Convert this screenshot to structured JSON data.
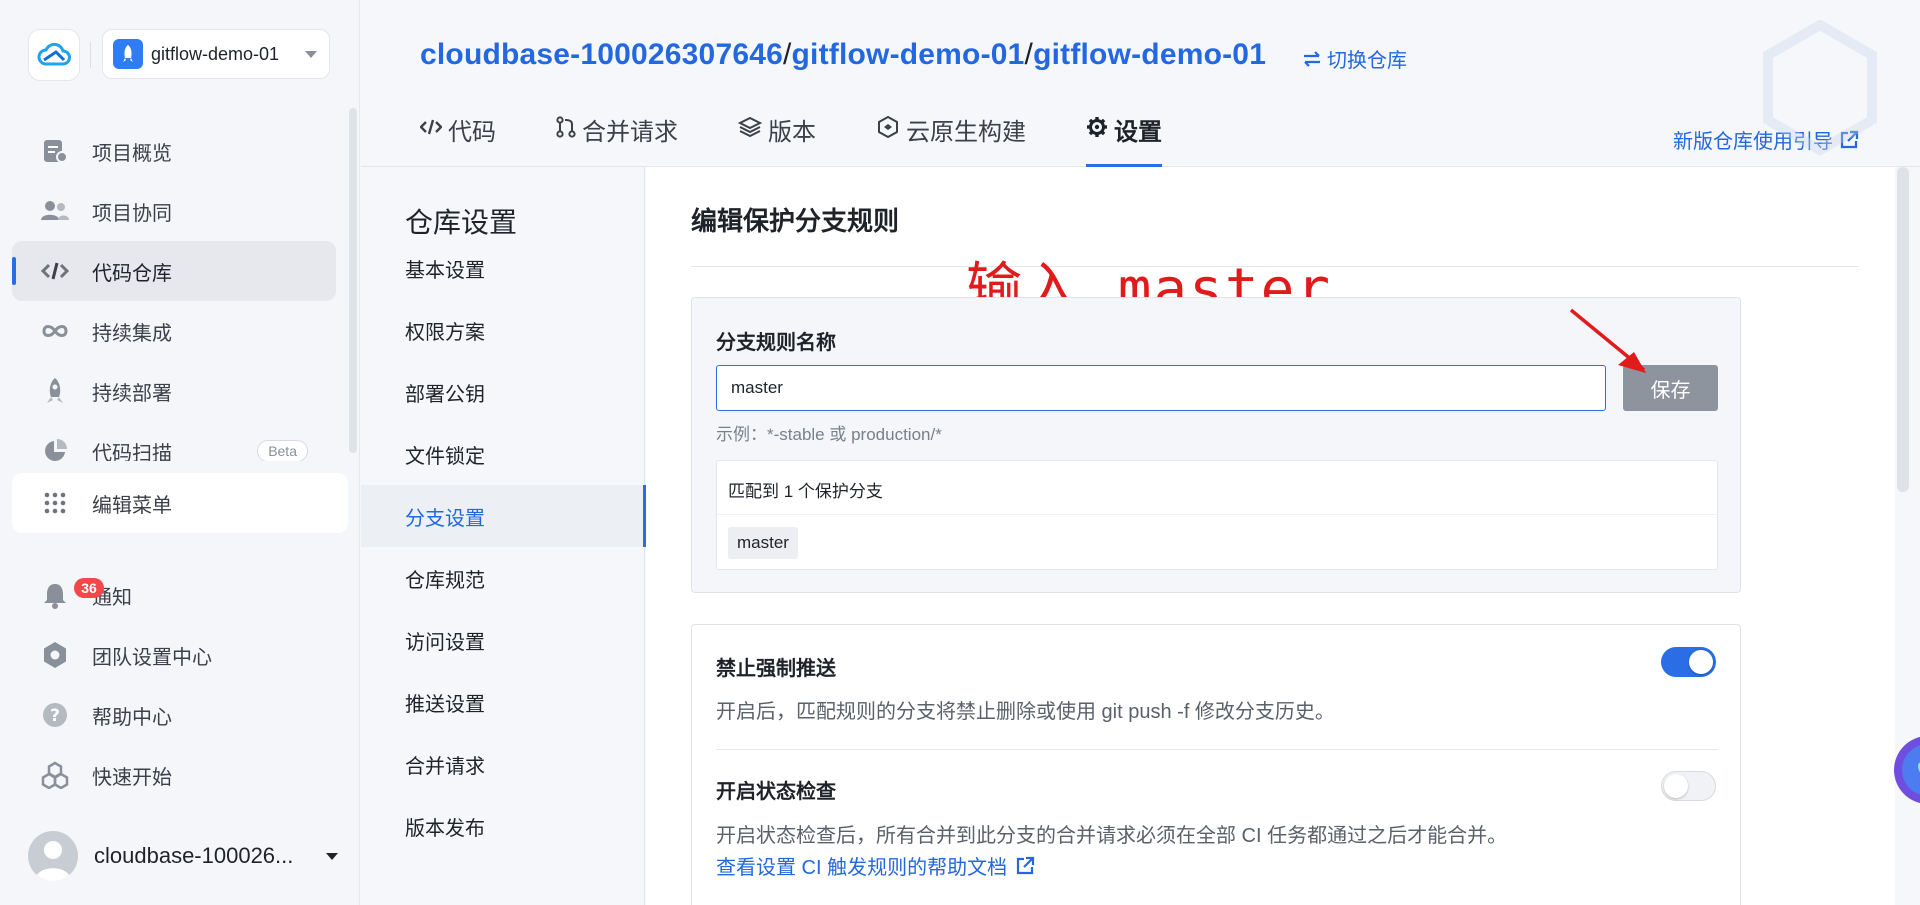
{
  "sidebar": {
    "project_name": "gitflow-demo-01",
    "nav_items": [
      {
        "label": "项目概览",
        "icon": "project-overview-icon"
      },
      {
        "label": "项目协同",
        "icon": "users-icon"
      },
      {
        "label": "代码仓库",
        "icon": "code-icon",
        "active": true
      },
      {
        "label": "持续集成",
        "icon": "infinity-icon"
      },
      {
        "label": "持续部署",
        "icon": "rocket-icon"
      },
      {
        "label": "代码扫描",
        "icon": "pie-chart-icon",
        "badge": "Beta"
      }
    ],
    "edit_menu_label": "编辑菜单",
    "bottom_items": [
      {
        "label": "通知",
        "icon": "bell-icon",
        "badge": "36"
      },
      {
        "label": "团队设置中心",
        "icon": "team-settings-icon"
      },
      {
        "label": "帮助中心",
        "icon": "help-icon"
      },
      {
        "label": "快速开始",
        "icon": "quick-start-icon"
      }
    ],
    "user_name": "cloudbase-100026..."
  },
  "header": {
    "repo_owner": "cloudbase-100026307646",
    "repo_group": "gitflow-demo-01",
    "repo_name": "gitflow-demo-01",
    "separator": "/",
    "switch_repo": "切换仓库",
    "tabs": [
      {
        "label": "代码",
        "icon": "code-icon"
      },
      {
        "label": "合并请求",
        "icon": "merge-request-icon"
      },
      {
        "label": "版本",
        "icon": "layers-icon"
      },
      {
        "label": "云原生构建",
        "icon": "cloud-build-icon"
      },
      {
        "label": "设置",
        "icon": "gear-icon",
        "active": true
      }
    ],
    "guide_link": "新版仓库使用引导"
  },
  "settings_nav": {
    "title": "仓库设置",
    "items": [
      "基本设置",
      "权限方案",
      "部署公钥",
      "文件锁定",
      "分支设置",
      "仓库规范",
      "访问设置",
      "推送设置",
      "合并请求",
      "版本发布"
    ],
    "active": "分支设置"
  },
  "main": {
    "title": "编辑保护分支规则",
    "annotation": "输入 master",
    "rule": {
      "label": "分支规则名称",
      "input_value": "master",
      "save_label": "保存",
      "example": "示例：*-stable 或 production/*",
      "match_text": "匹配到 1 个保护分支",
      "matched_branch": "master"
    },
    "options": [
      {
        "title": "禁止强制推送",
        "desc": "开启后，匹配规则的分支将禁止删除或使用 git push -f 修改分支历史。",
        "enabled": true
      },
      {
        "title": "开启状态检查",
        "desc": "开启状态检查后，所有合并到此分支的合并请求必须在全部 CI 任务都通过之后才能合并。",
        "enabled": false,
        "link": "查看设置 CI 触发规则的帮助文档"
      }
    ]
  },
  "colors": {
    "accent": "#2b6de5",
    "link": "#2368e0",
    "annotation": "#e01b1b",
    "badge": "#f5464a",
    "save_button": "#8d949e"
  }
}
